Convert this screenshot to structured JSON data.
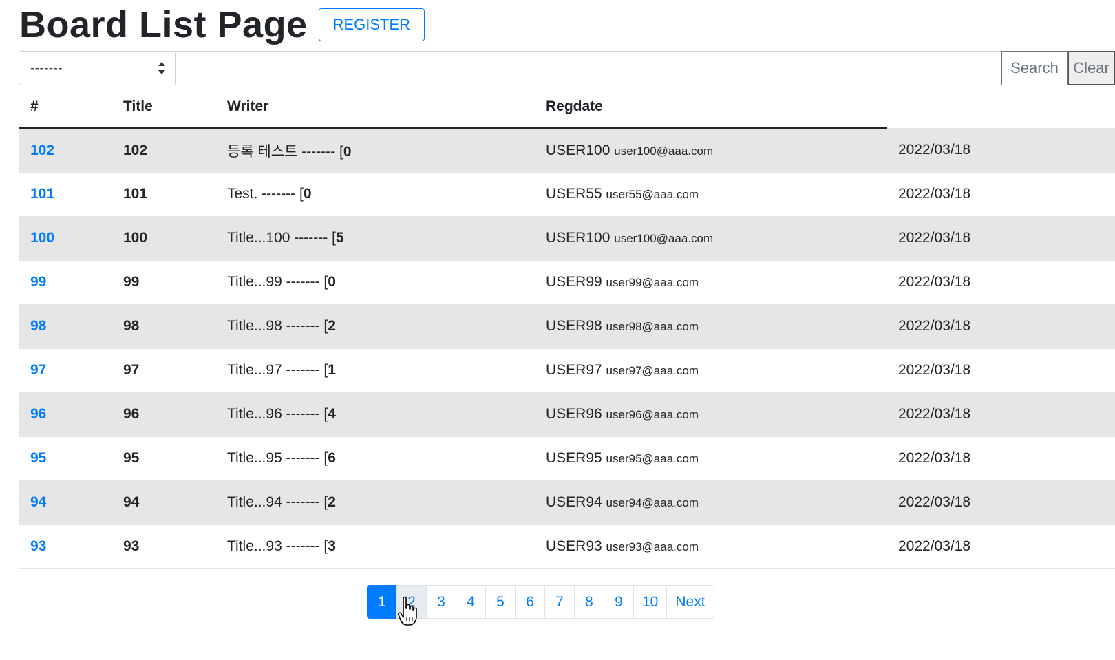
{
  "header": {
    "title": "Board List Page",
    "register_label": "REGISTER"
  },
  "search": {
    "type_selected": "-------",
    "keyword_value": "",
    "search_label": "Search",
    "clear_label": "Clear"
  },
  "table": {
    "columns": [
      "#",
      "Title",
      "Writer",
      "Regdate"
    ],
    "rows": [
      {
        "bno": "102",
        "bno2": "102",
        "title": "등록 테스트 ------- [",
        "replies": "0",
        "writer": "USER100",
        "email": "user100@aaa.com",
        "regdate": "2022/03/18"
      },
      {
        "bno": "101",
        "bno2": "101",
        "title": "Test. ------- [",
        "replies": "0",
        "writer": "USER55",
        "email": "user55@aaa.com",
        "regdate": "2022/03/18"
      },
      {
        "bno": "100",
        "bno2": "100",
        "title": "Title...100 ------- [",
        "replies": "5",
        "writer": "USER100",
        "email": "user100@aaa.com",
        "regdate": "2022/03/18"
      },
      {
        "bno": "99",
        "bno2": "99",
        "title": "Title...99 ------- [",
        "replies": "0",
        "writer": "USER99",
        "email": "user99@aaa.com",
        "regdate": "2022/03/18"
      },
      {
        "bno": "98",
        "bno2": "98",
        "title": "Title...98 ------- [",
        "replies": "2",
        "writer": "USER98",
        "email": "user98@aaa.com",
        "regdate": "2022/03/18"
      },
      {
        "bno": "97",
        "bno2": "97",
        "title": "Title...97 ------- [",
        "replies": "1",
        "writer": "USER97",
        "email": "user97@aaa.com",
        "regdate": "2022/03/18"
      },
      {
        "bno": "96",
        "bno2": "96",
        "title": "Title...96 ------- [",
        "replies": "4",
        "writer": "USER96",
        "email": "user96@aaa.com",
        "regdate": "2022/03/18"
      },
      {
        "bno": "95",
        "bno2": "95",
        "title": "Title...95 ------- [",
        "replies": "6",
        "writer": "USER95",
        "email": "user95@aaa.com",
        "regdate": "2022/03/18"
      },
      {
        "bno": "94",
        "bno2": "94",
        "title": "Title...94 ------- [",
        "replies": "2",
        "writer": "USER94",
        "email": "user94@aaa.com",
        "regdate": "2022/03/18"
      },
      {
        "bno": "93",
        "bno2": "93",
        "title": "Title...93 ------- [",
        "replies": "3",
        "writer": "USER93",
        "email": "user93@aaa.com",
        "regdate": "2022/03/18"
      }
    ]
  },
  "pagination": {
    "pages": [
      "1",
      "2",
      "3",
      "4",
      "5",
      "6",
      "7",
      "8",
      "9",
      "10"
    ],
    "active": "1",
    "next_label": "Next"
  },
  "colors": {
    "primary": "#007bff",
    "stripe": "#e6e6e6",
    "text": "#212529",
    "secondary": "#6c757d"
  },
  "icons": {
    "select": "updown-arrows-icon",
    "cursor": "hand-pointer-icon"
  }
}
